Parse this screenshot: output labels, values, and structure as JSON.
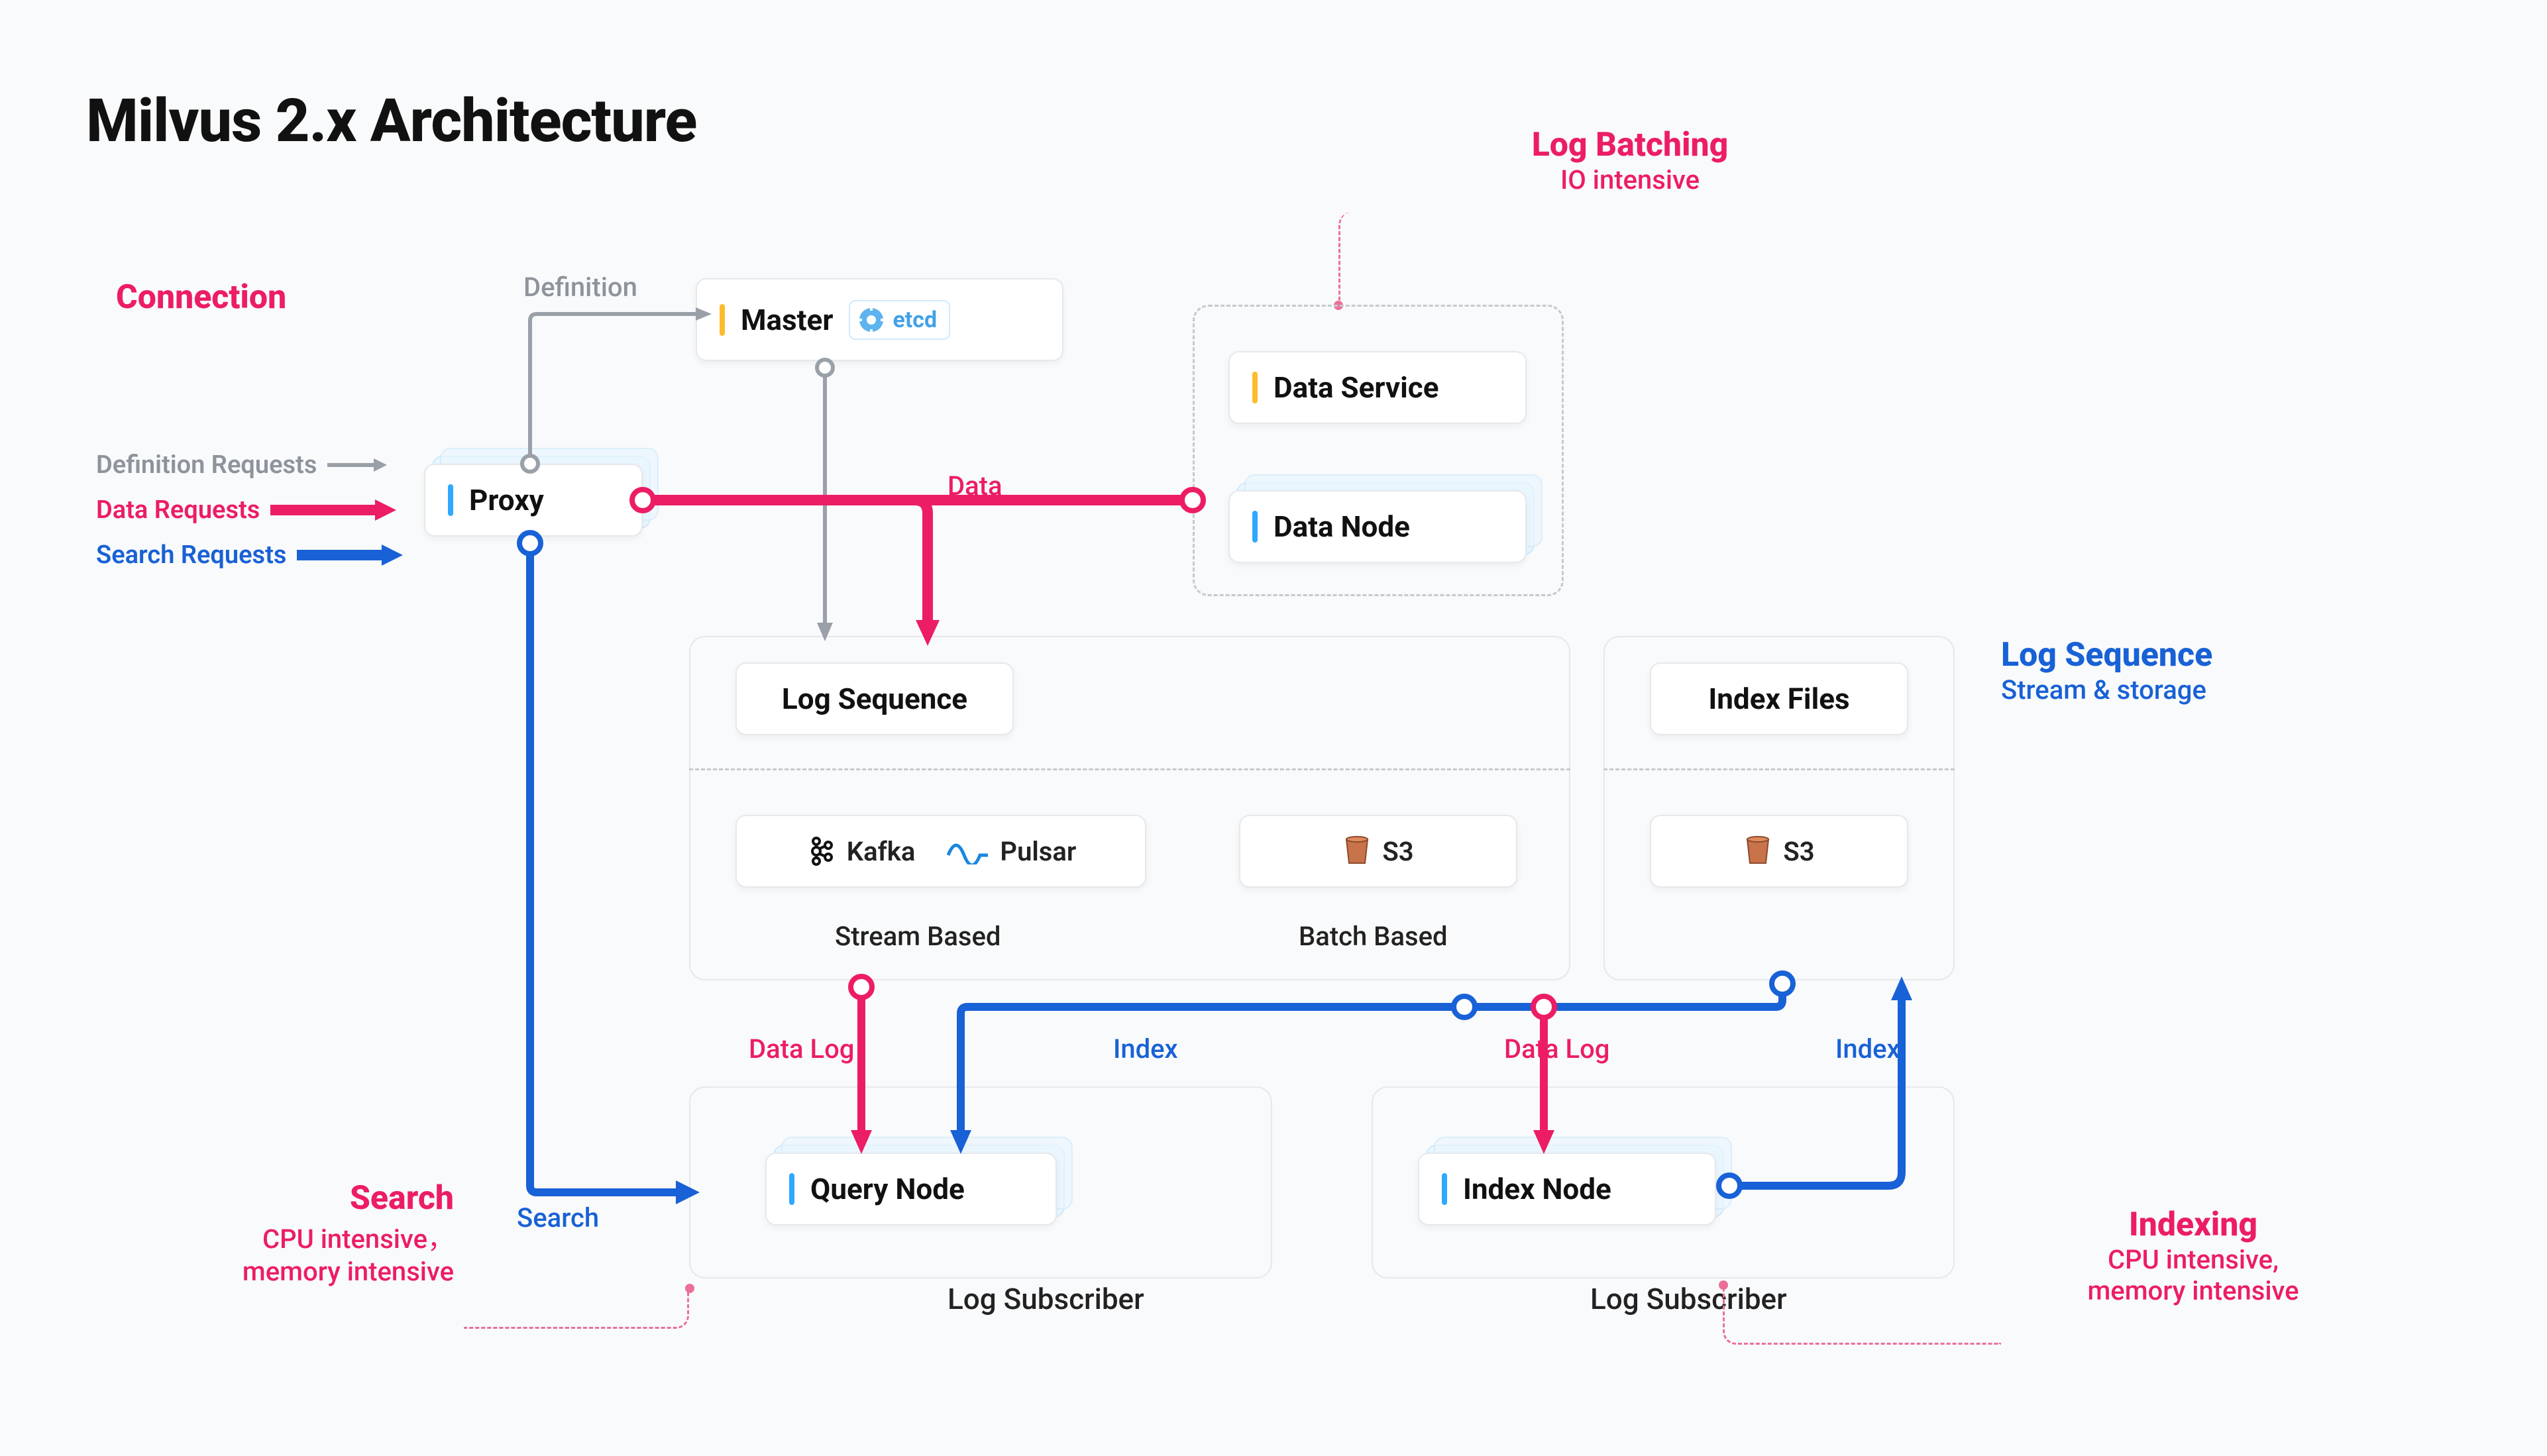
{
  "title": "Milvus 2.x Architecture",
  "callouts": {
    "connection": {
      "title": "Connection"
    },
    "log_batching": {
      "title": "Log Batching",
      "subtitle": "IO intensive"
    },
    "log_sequence_side": {
      "title": "Log Sequence",
      "subtitle": "Stream & storage"
    },
    "search": {
      "title": "Search",
      "subtitle": "CPU intensive，\nmemory intensive"
    },
    "indexing": {
      "title": "Indexing",
      "subtitle": "CPU intensive,\nmemory intensive"
    }
  },
  "requests": {
    "definition": "Definition Requests",
    "data": "Data Requests",
    "search": "Search Requests"
  },
  "nodes": {
    "proxy": "Proxy",
    "master": "Master",
    "etcd": "etcd",
    "data_service": "Data Service",
    "data_node": "Data Node",
    "log_sequence": "Log Sequence",
    "index_files": "Index Files",
    "kafka": "Kafka",
    "pulsar": "Pulsar",
    "s3_a": "S3",
    "s3_b": "S3",
    "query_node": "Query Node",
    "index_node": "Index Node"
  },
  "sections": {
    "stream_based": "Stream Based",
    "batch_based": "Batch Based",
    "log_subscriber_q": "Log Subscriber",
    "log_subscriber_i": "Log Subscriber"
  },
  "edge_labels": {
    "definition": "Definition",
    "data": "Data",
    "search": "Search",
    "data_log_q": "Data Log",
    "data_log_i": "Data Log",
    "index_to_query": "Index",
    "index_out": "Index"
  }
}
